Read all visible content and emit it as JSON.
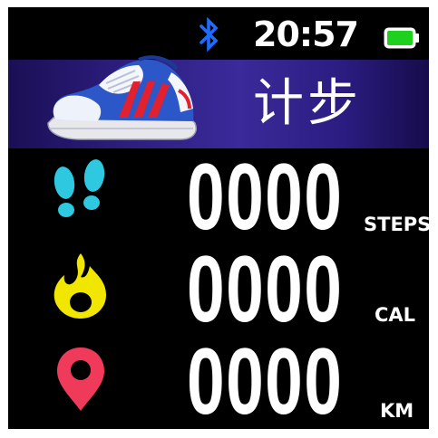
{
  "status_bar": {
    "time": "20:57",
    "bluetooth_icon": "bluetooth-icon",
    "battery_icon": "battery-full-icon",
    "battery_color": "#1fd11f"
  },
  "header": {
    "title": "计步",
    "image_icon": "sneaker-icon",
    "background_color": "#2e1f82"
  },
  "metrics": [
    {
      "icon": "footprints-icon",
      "icon_color": "#2ec8e0",
      "value": "0000",
      "unit": "STEPS"
    },
    {
      "icon": "flame-icon",
      "icon_color": "#f0e600",
      "value": "0000",
      "unit": "CAL"
    },
    {
      "icon": "location-pin-icon",
      "icon_color": "#f03a5a",
      "value": "0000",
      "unit": "KM"
    }
  ]
}
